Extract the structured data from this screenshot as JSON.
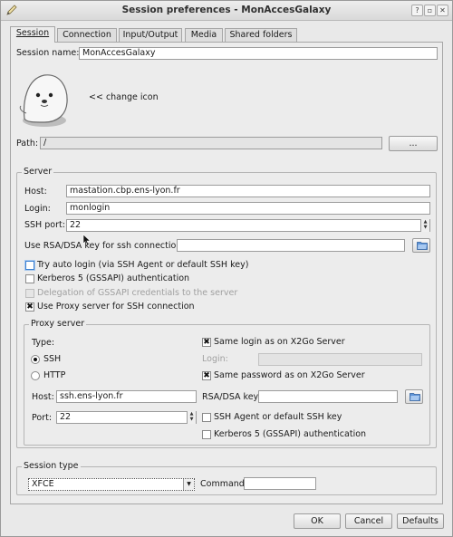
{
  "window": {
    "title": "Session preferences - MonAccesGalaxy"
  },
  "tabs": [
    {
      "label": "Session"
    },
    {
      "label": "Connection"
    },
    {
      "label": "Input/Output"
    },
    {
      "label": "Media"
    },
    {
      "label": "Shared folders"
    }
  ],
  "session": {
    "name_label": "Session name:",
    "name_value": "MonAccesGalaxy",
    "change_icon_label": "<< change icon",
    "path_label": "Path:",
    "path_value": "/",
    "browse_label": "..."
  },
  "server": {
    "group_title": "Server",
    "host_label": "Host:",
    "host_value": "mastation.cbp.ens-lyon.fr",
    "login_label": "Login:",
    "login_value": "monlogin",
    "ssh_port_label": "SSH port:",
    "ssh_port_value": "22",
    "rsa_label": "Use RSA/DSA key for ssh connection:",
    "rsa_value": "",
    "try_auto_login": {
      "label": "Try auto login (via SSH Agent or default SSH key)",
      "checked": false
    },
    "kerberos": {
      "label": "Kerberos 5 (GSSAPI) authentication",
      "checked": false
    },
    "delegation": {
      "label": "Delegation of GSSAPI credentials to the server",
      "checked": false
    },
    "use_proxy": {
      "label": "Use Proxy server for SSH connection",
      "checked": true
    }
  },
  "proxy": {
    "group_title": "Proxy server",
    "type_label": "Type:",
    "type_ssh": "SSH",
    "type_http": "HTTP",
    "selected_type": "SSH",
    "same_login": {
      "label": "Same login as on X2Go Server",
      "checked": true
    },
    "login_label": "Login:",
    "login_value": "",
    "same_password": {
      "label": "Same password as on X2Go Server",
      "checked": true
    },
    "host_label": "Host:",
    "host_value": "ssh.ens-lyon.fr",
    "rsa_label": "RSA/DSA key:",
    "rsa_value": "",
    "port_label": "Port:",
    "port_value": "22",
    "ssh_agent": {
      "label": "SSH Agent or default SSH key",
      "checked": false
    },
    "kerberos": {
      "label": "Kerberos 5 (GSSAPI) authentication",
      "checked": false
    }
  },
  "session_type": {
    "group_title": "Session type",
    "selected": "XFCE",
    "command_label": "Command:",
    "command_value": ""
  },
  "buttons": {
    "ok": "OK",
    "cancel": "Cancel",
    "defaults": "Defaults"
  },
  "colors": {
    "accent": "#3a7fd0",
    "window_bg": "#e9e9e9"
  }
}
